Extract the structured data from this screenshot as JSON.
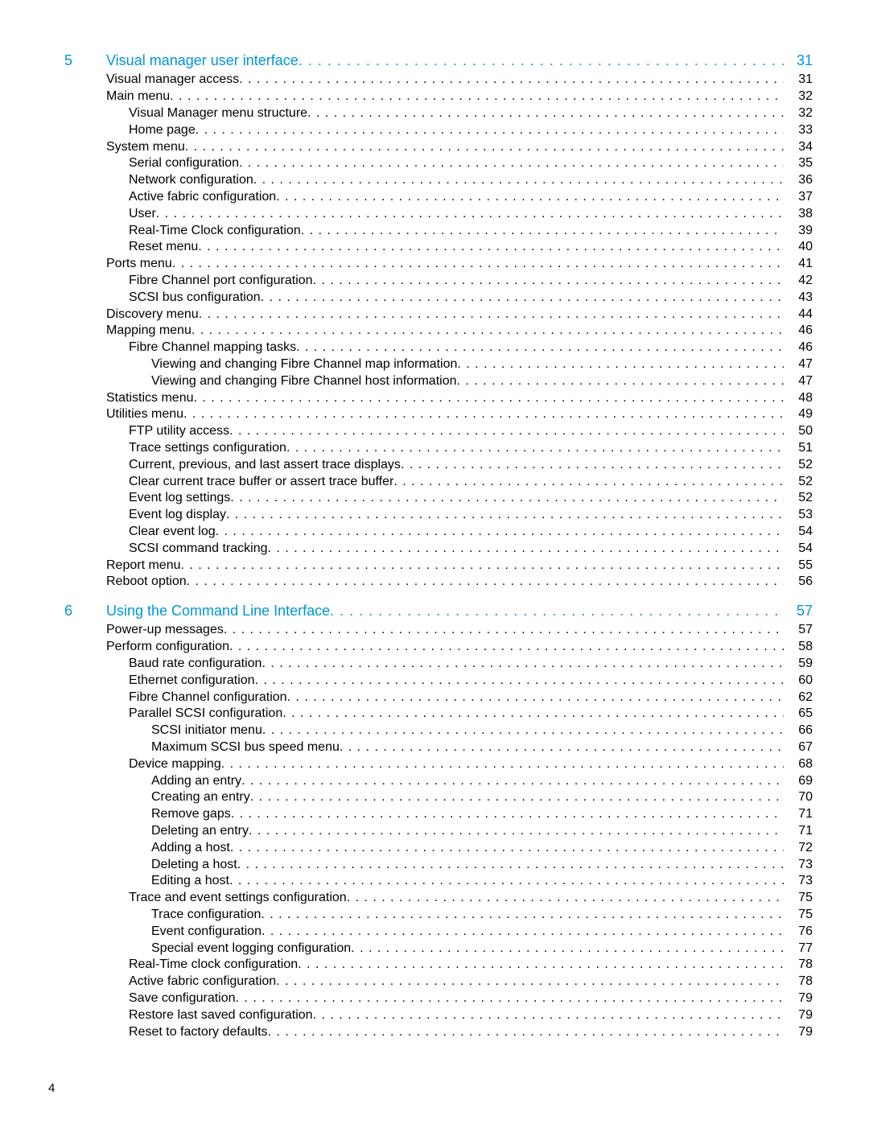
{
  "page_footer": "4",
  "toc": [
    {
      "chapter_num": "5",
      "indent": 0,
      "title": "Visual manager user interface",
      "page": "31",
      "is_chapter": true
    },
    {
      "indent": 0,
      "title": "Visual manager access",
      "page": "31"
    },
    {
      "indent": 0,
      "title": "Main menu",
      "page": "32"
    },
    {
      "indent": 1,
      "title": "Visual Manager menu structure",
      "page": "32"
    },
    {
      "indent": 1,
      "title": "Home page",
      "page": "33"
    },
    {
      "indent": 0,
      "title": "System menu",
      "page": "34"
    },
    {
      "indent": 1,
      "title": "Serial configuration",
      "page": "35"
    },
    {
      "indent": 1,
      "title": "Network configuration",
      "page": "36"
    },
    {
      "indent": 1,
      "title": "Active fabric configuration",
      "page": "37"
    },
    {
      "indent": 1,
      "title": "User",
      "page": "38"
    },
    {
      "indent": 1,
      "title": "Real-Time Clock configuration",
      "page": "39"
    },
    {
      "indent": 1,
      "title": "Reset menu",
      "page": "40"
    },
    {
      "indent": 0,
      "title": "Ports menu",
      "page": "41"
    },
    {
      "indent": 1,
      "title": "Fibre Channel port configuration",
      "page": "42"
    },
    {
      "indent": 1,
      "title": "SCSI bus configuration",
      "page": "43"
    },
    {
      "indent": 0,
      "title": "Discovery menu",
      "page": "44"
    },
    {
      "indent": 0,
      "title": "Mapping menu",
      "page": "46"
    },
    {
      "indent": 1,
      "title": "Fibre Channel mapping tasks",
      "page": "46"
    },
    {
      "indent": 2,
      "title": "Viewing and changing Fibre Channel map information",
      "page": "47"
    },
    {
      "indent": 2,
      "title": "Viewing and changing Fibre Channel host information",
      "page": "47"
    },
    {
      "indent": 0,
      "title": "Statistics menu",
      "page": "48"
    },
    {
      "indent": 0,
      "title": "Utilities menu",
      "page": "49"
    },
    {
      "indent": 1,
      "title": "FTP utility access",
      "page": "50"
    },
    {
      "indent": 1,
      "title": "Trace settings configuration",
      "page": "51"
    },
    {
      "indent": 1,
      "title": "Current, previous, and last assert trace displays",
      "page": "52"
    },
    {
      "indent": 1,
      "title": "Clear current trace buffer or assert trace buffer",
      "page": "52"
    },
    {
      "indent": 1,
      "title": "Event log settings",
      "page": "52"
    },
    {
      "indent": 1,
      "title": "Event log display",
      "page": "53"
    },
    {
      "indent": 1,
      "title": "Clear event log",
      "page": "54"
    },
    {
      "indent": 1,
      "title": "SCSI command tracking",
      "page": "54"
    },
    {
      "indent": 0,
      "title": "Report menu",
      "page": "55"
    },
    {
      "indent": 0,
      "title": "Reboot option",
      "page": "56"
    },
    {
      "chapter_num": "6",
      "indent": 0,
      "title": "Using the Command Line Interface",
      "page": "57",
      "is_chapter": true
    },
    {
      "indent": 0,
      "title": "Power-up messages",
      "page": "57"
    },
    {
      "indent": 0,
      "title": "Perform configuration",
      "page": "58"
    },
    {
      "indent": 1,
      "title": "Baud rate configuration",
      "page": "59"
    },
    {
      "indent": 1,
      "title": "Ethernet configuration",
      "page": "60"
    },
    {
      "indent": 1,
      "title": "Fibre Channel configuration",
      "page": "62"
    },
    {
      "indent": 1,
      "title": "Parallel SCSI configuration",
      "page": "65"
    },
    {
      "indent": 2,
      "title": "SCSI initiator menu",
      "page": "66"
    },
    {
      "indent": 2,
      "title": "Maximum SCSI bus speed menu",
      "page": "67"
    },
    {
      "indent": 1,
      "title": "Device mapping",
      "page": "68"
    },
    {
      "indent": 2,
      "title": "Adding an entry",
      "page": "69"
    },
    {
      "indent": 2,
      "title": "Creating an entry",
      "page": "70"
    },
    {
      "indent": 2,
      "title": "Remove gaps",
      "page": "71"
    },
    {
      "indent": 2,
      "title": "Deleting an entry",
      "page": "71"
    },
    {
      "indent": 2,
      "title": "Adding a host",
      "page": "72"
    },
    {
      "indent": 2,
      "title": "Deleting a host",
      "page": "73"
    },
    {
      "indent": 2,
      "title": "Editing a host",
      "page": "73"
    },
    {
      "indent": 1,
      "title": "Trace and event settings configuration",
      "page": "75"
    },
    {
      "indent": 2,
      "title": "Trace configuration",
      "page": "75"
    },
    {
      "indent": 2,
      "title": "Event configuration",
      "page": "76"
    },
    {
      "indent": 2,
      "title": "Special event logging configuration",
      "page": "77"
    },
    {
      "indent": 1,
      "title": "Real-Time clock configuration",
      "page": "78"
    },
    {
      "indent": 1,
      "title": "Active fabric configuration",
      "page": "78"
    },
    {
      "indent": 1,
      "title": "Save configuration",
      "page": "79"
    },
    {
      "indent": 1,
      "title": "Restore last saved configuration",
      "page": "79"
    },
    {
      "indent": 1,
      "title": "Reset to factory defaults",
      "page": "79"
    }
  ]
}
